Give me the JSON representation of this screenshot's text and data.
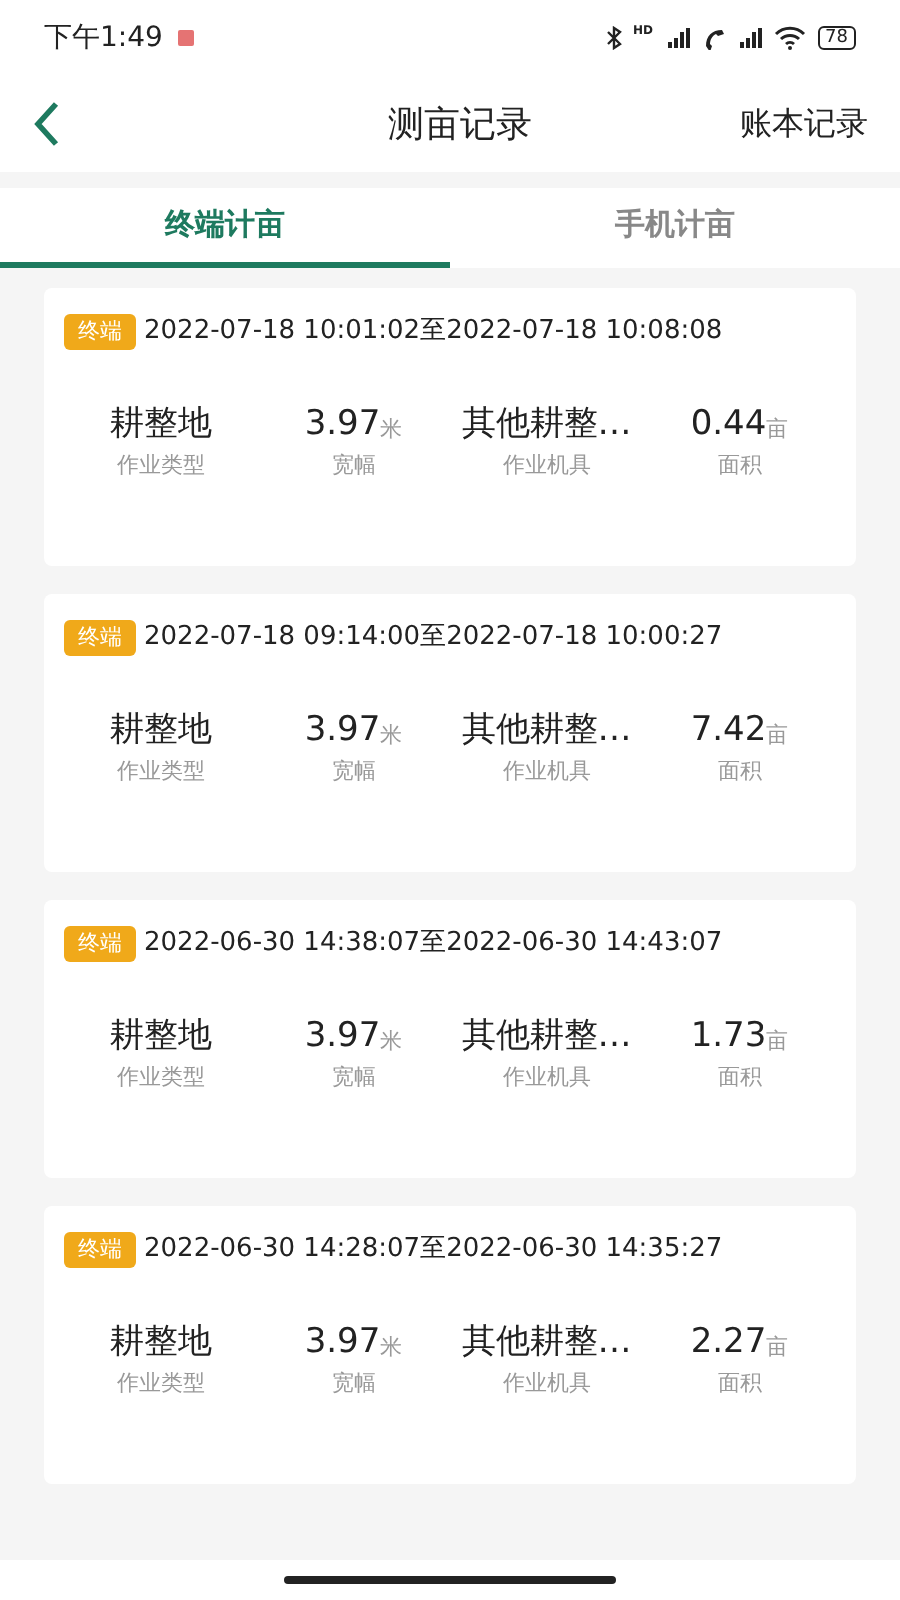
{
  "status_bar": {
    "time": "下午1:49",
    "network_label": "HD",
    "battery": "78"
  },
  "header": {
    "title": "测亩记录",
    "action": "账本记录"
  },
  "tabs": [
    {
      "label": "终端计亩",
      "selected": true
    },
    {
      "label": "手机计亩",
      "selected": false
    }
  ],
  "records": [
    {
      "tag": "终端",
      "time_range": "2022-07-18 10:01:02至2022-07-18 10:08:08",
      "stats": [
        {
          "value": "耕整地",
          "label": "作业类型"
        },
        {
          "value": "3.97",
          "unit": "米",
          "label": "宽幅"
        },
        {
          "value": "其他耕整…",
          "label": "作业机具"
        },
        {
          "value": "0.44",
          "unit": "亩",
          "label": "面积"
        }
      ]
    },
    {
      "tag": "终端",
      "time_range": "2022-07-18 09:14:00至2022-07-18 10:00:27",
      "stats": [
        {
          "value": "耕整地",
          "label": "作业类型"
        },
        {
          "value": "3.97",
          "unit": "米",
          "label": "宽幅"
        },
        {
          "value": "其他耕整…",
          "label": "作业机具"
        },
        {
          "value": "7.42",
          "unit": "亩",
          "label": "面积"
        }
      ]
    },
    {
      "tag": "终端",
      "time_range": "2022-06-30 14:38:07至2022-06-30 14:43:07",
      "stats": [
        {
          "value": "耕整地",
          "label": "作业类型"
        },
        {
          "value": "3.97",
          "unit": "米",
          "label": "宽幅"
        },
        {
          "value": "其他耕整…",
          "label": "作业机具"
        },
        {
          "value": "1.73",
          "unit": "亩",
          "label": "面积"
        }
      ]
    },
    {
      "tag": "终端",
      "time_range": "2022-06-30 14:28:07至2022-06-30 14:35:27",
      "stats": [
        {
          "value": "耕整地",
          "label": "作业类型"
        },
        {
          "value": "3.97",
          "unit": "米",
          "label": "宽幅"
        },
        {
          "value": "其他耕整…",
          "label": "作业机具"
        },
        {
          "value": "2.27",
          "unit": "亩",
          "label": "面积"
        }
      ]
    }
  ]
}
